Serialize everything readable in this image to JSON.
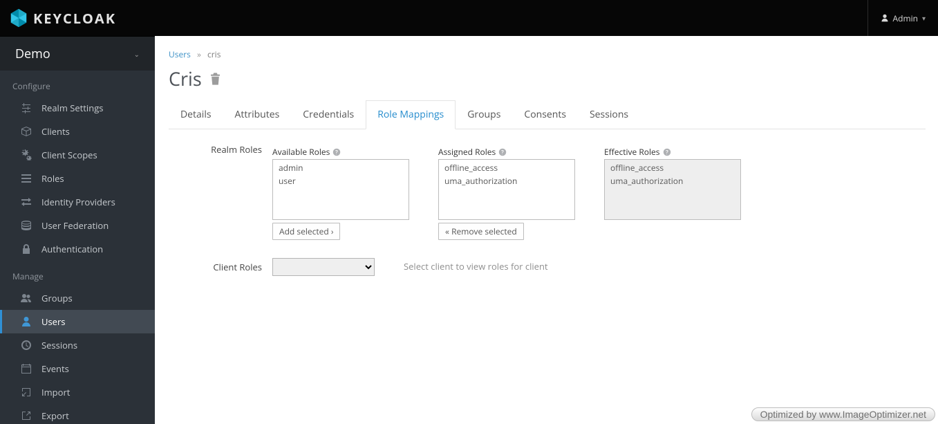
{
  "header": {
    "logo_text": "KEYCLOAK",
    "user_label": "Admin"
  },
  "sidebar": {
    "realm": "Demo",
    "sections": {
      "configure": {
        "heading": "Configure",
        "items": [
          {
            "label": "Realm Settings",
            "icon": "sliders"
          },
          {
            "label": "Clients",
            "icon": "cube"
          },
          {
            "label": "Client Scopes",
            "icon": "gears"
          },
          {
            "label": "Roles",
            "icon": "list"
          },
          {
            "label": "Identity Providers",
            "icon": "exchange"
          },
          {
            "label": "User Federation",
            "icon": "database"
          },
          {
            "label": "Authentication",
            "icon": "lock"
          }
        ]
      },
      "manage": {
        "heading": "Manage",
        "items": [
          {
            "label": "Groups",
            "icon": "users"
          },
          {
            "label": "Users",
            "icon": "user",
            "active": true
          },
          {
            "label": "Sessions",
            "icon": "clock"
          },
          {
            "label": "Events",
            "icon": "calendar"
          },
          {
            "label": "Import",
            "icon": "import"
          },
          {
            "label": "Export",
            "icon": "export"
          }
        ]
      }
    }
  },
  "breadcrumb": {
    "parent": "Users",
    "current": "cris"
  },
  "page": {
    "title": "Cris"
  },
  "tabs": [
    {
      "label": "Details"
    },
    {
      "label": "Attributes"
    },
    {
      "label": "Credentials"
    },
    {
      "label": "Role Mappings",
      "active": true
    },
    {
      "label": "Groups"
    },
    {
      "label": "Consents"
    },
    {
      "label": "Sessions"
    }
  ],
  "roles": {
    "row_label": "Realm Roles",
    "available": {
      "label": "Available Roles",
      "items": [
        "admin",
        "user"
      ],
      "button": "Add selected ›"
    },
    "assigned": {
      "label": "Assigned Roles",
      "items": [
        "offline_access",
        "uma_authorization"
      ],
      "button": "« Remove selected"
    },
    "effective": {
      "label": "Effective Roles",
      "items": [
        "offline_access",
        "uma_authorization"
      ]
    }
  },
  "client_roles": {
    "row_label": "Client Roles",
    "selected": "",
    "hint": "Select client to view roles for client"
  },
  "watermark": "Optimized by www.ImageOptimizer.net"
}
